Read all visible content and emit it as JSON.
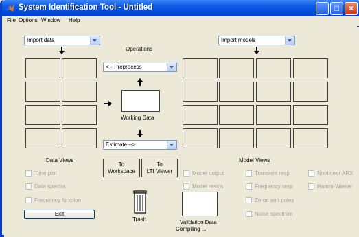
{
  "window": {
    "title": "System Identification Tool - Untitled"
  },
  "titlebar_buttons": {
    "minimize": "_",
    "maximize": "□",
    "close": "×"
  },
  "menu": [
    "File",
    "Options",
    "Window",
    "Help"
  ],
  "data": {
    "import_label": "Import data",
    "views_title": "Data Views",
    "views": [
      "Time plot",
      "Data spectra",
      "Frequency function"
    ]
  },
  "operations": {
    "title": "Operations",
    "preprocess_label": "<-- Preprocess",
    "working_data_label": "Working Data",
    "estimate_label": "Estimate -->"
  },
  "buttons": {
    "to_workspace": [
      "To",
      "Workspace"
    ],
    "to_lti_viewer": [
      "To",
      "LTI Viewer"
    ],
    "exit": "Exit"
  },
  "trash": {
    "label": "Trash"
  },
  "models": {
    "import_label": "Import models",
    "views_title": "Model Views",
    "views_col1": [
      "Model output",
      "Model resids"
    ],
    "views_col2": [
      "Transient resp",
      "Frequency resp",
      "Zeros and poles",
      "Noise spectrum"
    ],
    "views_col3": [
      "Nonlinear ARX",
      "Hamm-Wiener"
    ]
  },
  "validation": {
    "label": "Validation Data"
  },
  "status": {
    "text": "Compiling ..."
  },
  "colors": {
    "titlebar": "#0a5ae6",
    "window_bg": "#ece9d8",
    "disabled_text": "#a0a09a"
  }
}
